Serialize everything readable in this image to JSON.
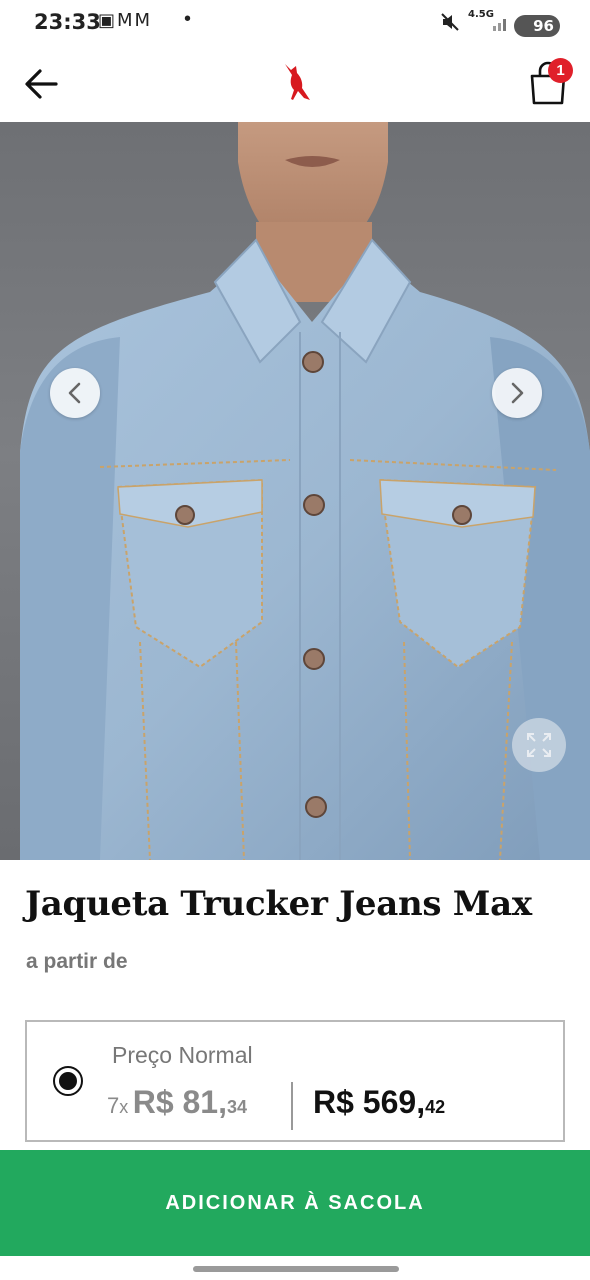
{
  "status_bar": {
    "time": "23:33",
    "left_icons": "▣ⅯⅯ",
    "network": "4.5G",
    "battery": "96"
  },
  "header": {
    "bag_count": "1"
  },
  "product": {
    "name": "Jaqueta Trucker Jeans Max",
    "from_label": "a partir de",
    "price_type": "Preço Normal",
    "installments_count": "7",
    "installments_x": "x",
    "installment_value": "R$ 81,",
    "installment_cents": "34",
    "full_price": "R$ 569,",
    "full_price_cents": "42"
  },
  "cta": {
    "add_to_bag": "ADICIONAR À SACOLA"
  },
  "colors": {
    "primary_green": "#22a95e",
    "badge_red": "#e0202a",
    "logo_red": "#d7191f"
  }
}
